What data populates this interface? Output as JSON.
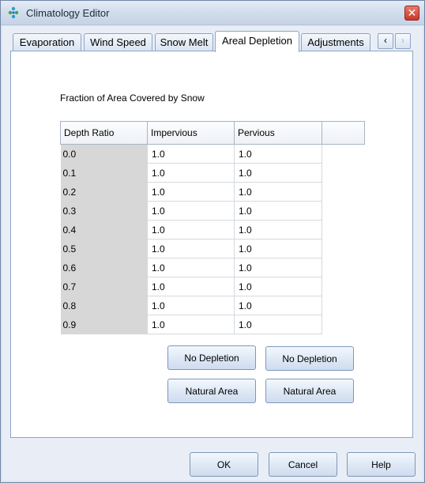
{
  "window": {
    "title": "Climatology Editor",
    "close_glyph": "✕"
  },
  "tabs": [
    {
      "label": "Evaporation",
      "active": false
    },
    {
      "label": "Wind Speed",
      "active": false
    },
    {
      "label": "Snow Melt",
      "active": false
    },
    {
      "label": "Areal Depletion",
      "active": true
    },
    {
      "label": "Adjustments",
      "active": false
    }
  ],
  "tab_scroll": {
    "left_glyph": "‹",
    "right_glyph": "›"
  },
  "areal_depletion": {
    "section_label": "Fraction of Area Covered by Snow",
    "columns": [
      "Depth Ratio",
      "Impervious",
      "Pervious",
      ""
    ],
    "rows": [
      {
        "depth_ratio": "0.0",
        "impervious": "1.0",
        "pervious": "1.0"
      },
      {
        "depth_ratio": "0.1",
        "impervious": "1.0",
        "pervious": "1.0"
      },
      {
        "depth_ratio": "0.2",
        "impervious": "1.0",
        "pervious": "1.0"
      },
      {
        "depth_ratio": "0.3",
        "impervious": "1.0",
        "pervious": "1.0"
      },
      {
        "depth_ratio": "0.4",
        "impervious": "1.0",
        "pervious": "1.0"
      },
      {
        "depth_ratio": "0.5",
        "impervious": "1.0",
        "pervious": "1.0"
      },
      {
        "depth_ratio": "0.6",
        "impervious": "1.0",
        "pervious": "1.0"
      },
      {
        "depth_ratio": "0.7",
        "impervious": "1.0",
        "pervious": "1.0"
      },
      {
        "depth_ratio": "0.8",
        "impervious": "1.0",
        "pervious": "1.0"
      },
      {
        "depth_ratio": "0.9",
        "impervious": "1.0",
        "pervious": "1.0"
      }
    ],
    "buttons": {
      "no_depletion_impervious": "No Depletion",
      "no_depletion_pervious": "No Depletion",
      "natural_area_impervious": "Natural Area",
      "natural_area_pervious": "Natural Area"
    }
  },
  "footer": {
    "ok": "OK",
    "cancel": "Cancel",
    "help": "Help"
  }
}
